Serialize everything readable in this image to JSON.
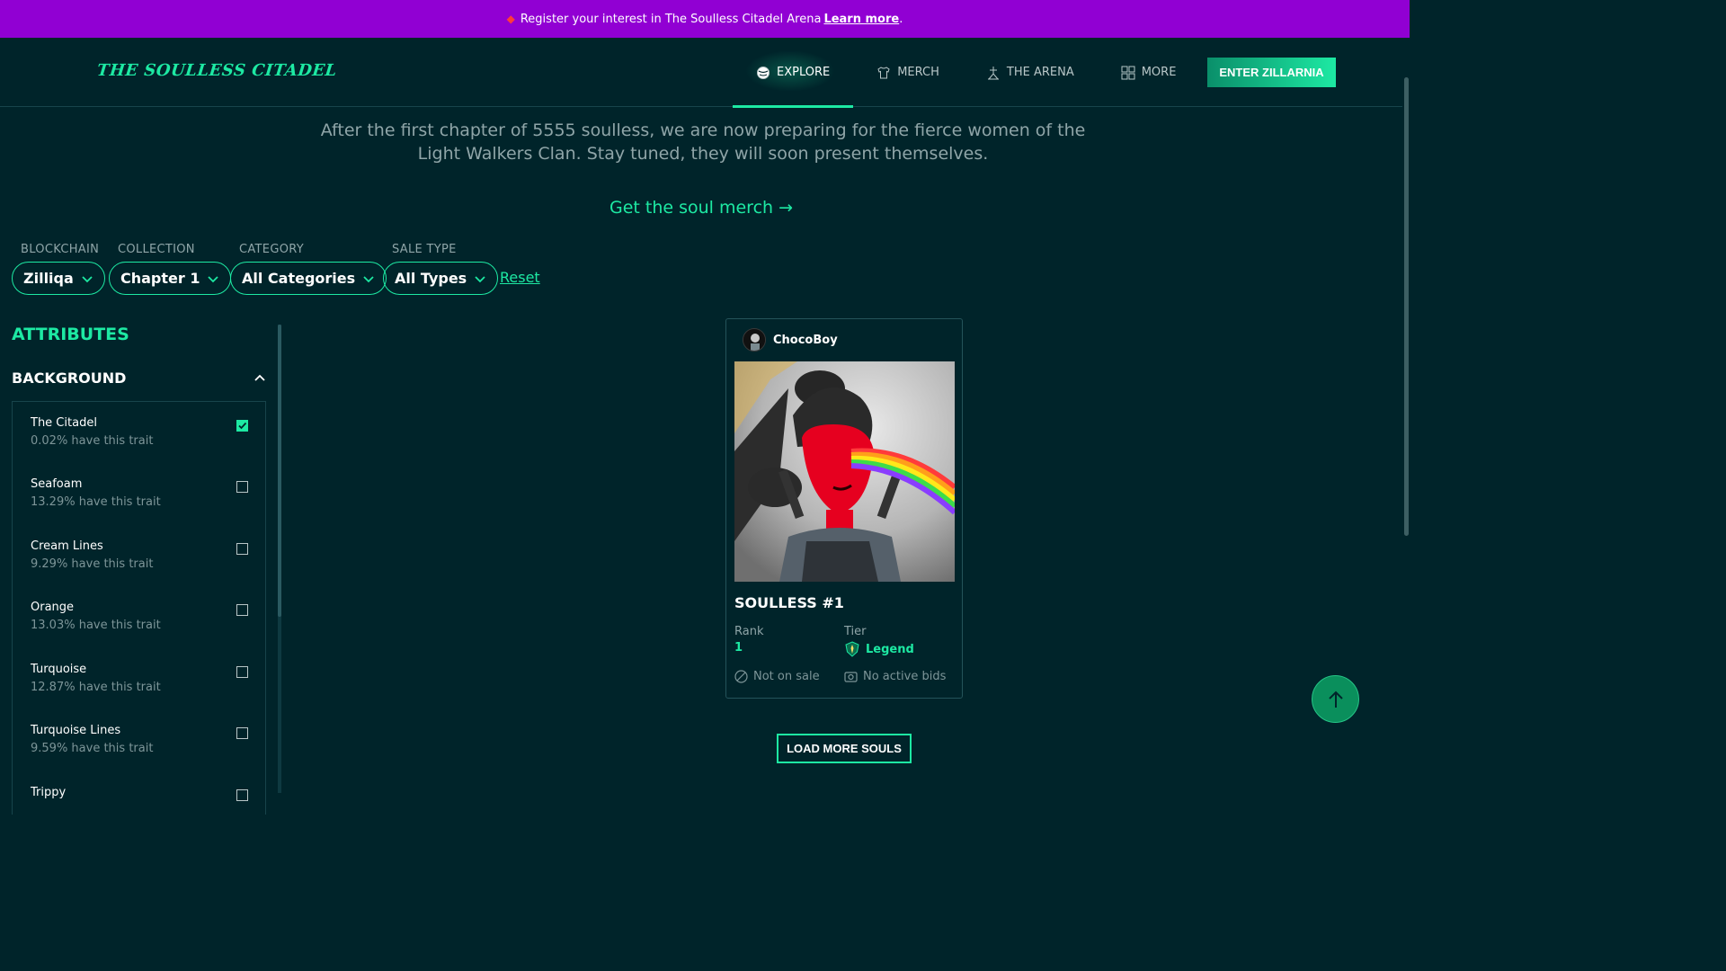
{
  "announcement": {
    "text": "Register your interest in The Soulless Citadel Arena",
    "link": "Learn more",
    "suffix": "."
  },
  "header": {
    "logo": "THE SOULLESS CITADEL",
    "nav": [
      {
        "label": "EXPLORE",
        "icon": "planet-icon",
        "active": true
      },
      {
        "label": "MERCH",
        "icon": "shirt-icon",
        "active": false
      },
      {
        "label": "THE ARENA",
        "icon": "arena-icon",
        "active": false
      },
      {
        "label": "MORE",
        "icon": "grid-icon",
        "active": false
      }
    ],
    "cta": "ENTER ZILLARNIA"
  },
  "intro": {
    "text": "After the first chapter of 5555 soulless, we are now preparing for the fierce women of the Light Walkers Clan. Stay tuned, they will soon present themselves.",
    "merch_link": "Get the soul merch →"
  },
  "filters": [
    {
      "label": "BLOCKCHAIN",
      "value": "Zilliqa"
    },
    {
      "label": "COLLECTION",
      "value": "Chapter 1"
    },
    {
      "label": "CATEGORY",
      "value": "All Categories"
    },
    {
      "label": "SALE TYPE",
      "value": "All Types"
    }
  ],
  "reset_label": "Reset",
  "sidebar": {
    "title": "ATTRIBUTES",
    "section": "BACKGROUND",
    "traits": [
      {
        "name": "The Citadel",
        "pct": "0.02% have this trait",
        "checked": true
      },
      {
        "name": "Seafoam",
        "pct": "13.29% have this trait",
        "checked": false
      },
      {
        "name": "Cream Lines",
        "pct": "9.29% have this trait",
        "checked": false
      },
      {
        "name": "Orange",
        "pct": "13.03% have this trait",
        "checked": false
      },
      {
        "name": "Turquoise",
        "pct": "12.87% have this trait",
        "checked": false
      },
      {
        "name": "Turquoise Lines",
        "pct": "9.59% have this trait",
        "checked": false
      },
      {
        "name": "Trippy",
        "pct": "",
        "checked": false
      }
    ]
  },
  "card": {
    "owner": "ChocoBoy",
    "title": "SOULLESS #1",
    "rank_label": "Rank",
    "rank_value": "1",
    "tier_label": "Tier",
    "tier_value": "Legend",
    "sale_status": "Not on sale",
    "bid_status": "No active bids"
  },
  "load_more": "LOAD MORE SOULS",
  "colors": {
    "background": "#00242a",
    "accent": "#1de9a3",
    "banner": "#9100d3"
  }
}
